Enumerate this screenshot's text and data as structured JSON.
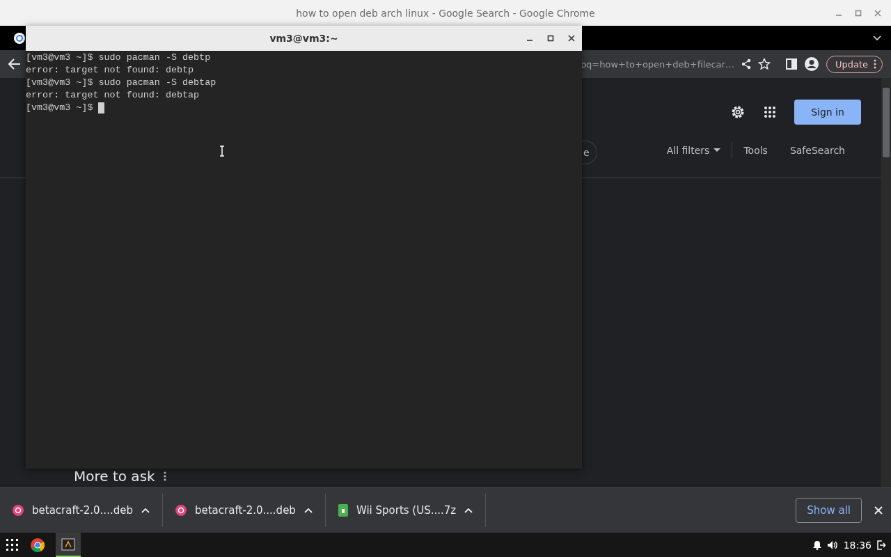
{
  "browser": {
    "title": "how to open deb arch linux - Google Search - Google Chrome",
    "address": "oq=how+to+open+deb+filecar…",
    "update_label": "Update"
  },
  "page": {
    "sign_in": "Sign in",
    "chip_partial": "e",
    "filters": [
      {
        "label": "All filters",
        "kind": "dropdown"
      },
      {
        "label": "Tools",
        "kind": "plain"
      },
      {
        "label": "SafeSearch",
        "kind": "plain"
      }
    ],
    "section_heading": "More to ask"
  },
  "terminal": {
    "title": "vm3@vm3:~",
    "lines": [
      "[vm3@vm3 ~]$ sudo pacman -S debtp",
      "error: target not found: debtp",
      "[vm3@vm3 ~]$ sudo pacman -S debtap",
      "error: target not found: debtap",
      "[vm3@vm3 ~]$ "
    ]
  },
  "downloads": {
    "items": [
      {
        "name": "betacraft-2.0....deb",
        "kind": "deb"
      },
      {
        "name": "betacraft-2.0....deb",
        "kind": "deb"
      },
      {
        "name": "Wii Sports (US....7z",
        "kind": "archive"
      }
    ],
    "show_all": "Show all"
  },
  "taskbar": {
    "apps": [
      {
        "kind": "chrome",
        "selected": false
      },
      {
        "kind": "terminal",
        "selected": true
      }
    ],
    "clock": "18:36"
  }
}
